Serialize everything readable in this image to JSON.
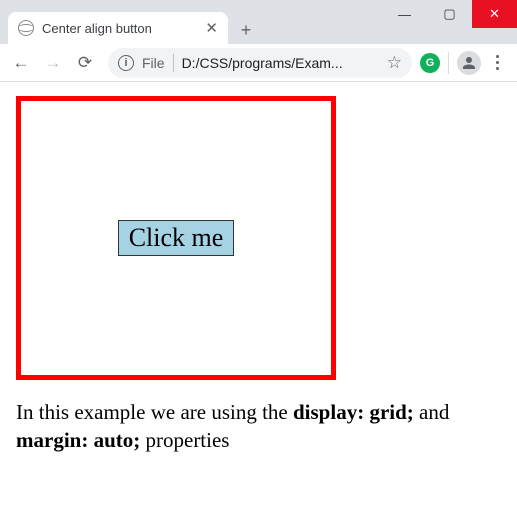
{
  "window": {
    "minimize": "—",
    "maximize": "▢",
    "close": "✕"
  },
  "tab": {
    "title": "Center align button",
    "close": "✕",
    "new": "+"
  },
  "toolbar": {
    "back": "←",
    "forward": "→",
    "reload": "⟳",
    "info": "i",
    "file_label": "File",
    "url": "D:/CSS/programs/Exam...",
    "star": "☆",
    "ext_g": "G",
    "menu": "⋮"
  },
  "page": {
    "button_label": "Click me",
    "desc_1": "In this example we are using the ",
    "desc_bold_1": "display: grid;",
    "desc_2": " and ",
    "desc_bold_2": "margin: auto;",
    "desc_3": " properties"
  }
}
